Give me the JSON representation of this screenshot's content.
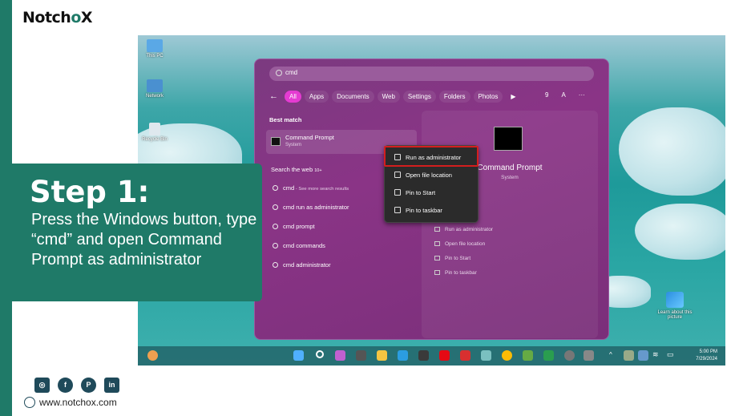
{
  "brand": {
    "logo_pre": "Notch",
    "logo_o": "o",
    "logo_post": "X",
    "website": "www.notchox.com"
  },
  "step": {
    "title": "Step 1:",
    "body": "Press the Windows button, type “cmd” and open Command Prompt as administrator"
  },
  "desktop": {
    "icons": [
      "This PC",
      "Network",
      "Recycle Bin"
    ],
    "learn": "Learn about this picture"
  },
  "search": {
    "query": "cmd"
  },
  "tabs": [
    "All",
    "Apps",
    "Documents",
    "Web",
    "Settings",
    "Folders",
    "Photos"
  ],
  "tools": {
    "count": "9",
    "letter": "A",
    "more": "···"
  },
  "best_match": {
    "heading": "Best match",
    "title": "Command Prompt",
    "sub": "System"
  },
  "web": {
    "heading": "Search the web",
    "badge": "10+",
    "items": [
      {
        "label": "cmd",
        "sub": " - See more search results"
      },
      {
        "label": "cmd run as administrator",
        "sub": ""
      },
      {
        "label": "cmd prompt",
        "sub": ""
      },
      {
        "label": "cmd commands",
        "sub": ""
      },
      {
        "label": "cmd administrator",
        "sub": ""
      }
    ]
  },
  "detail": {
    "title": "Command Prompt",
    "sub": "System",
    "actions": [
      "Run as administrator",
      "Open file location",
      "Pin to Start",
      "Pin to taskbar"
    ]
  },
  "context_menu": [
    "Run as administrator",
    "Open file location",
    "Pin to Start",
    "Pin to taskbar"
  ],
  "clock": {
    "time": "5:00 PM",
    "date": "7/29/2024"
  },
  "social": [
    "instagram-icon",
    "facebook-icon",
    "pinterest-icon",
    "linkedin-icon"
  ]
}
